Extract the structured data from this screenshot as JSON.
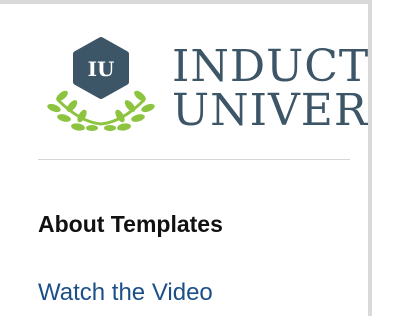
{
  "logo": {
    "badge_text": "IU",
    "line1": "INDUCTIVE",
    "line2": "UNIVERSITY",
    "badge_color": "#3d5667",
    "leaf_color": "#8cc33f"
  },
  "content": {
    "heading": "About Templates",
    "link_label": "Watch the Video",
    "link_color": "#1b4f88"
  }
}
